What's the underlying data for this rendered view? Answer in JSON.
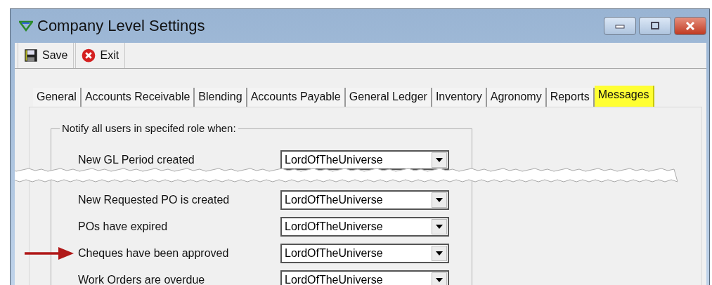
{
  "window": {
    "title": "Company Level Settings"
  },
  "toolbar": [
    {
      "label": "Save",
      "kind": "save"
    },
    {
      "label": "Exit",
      "kind": "exit"
    }
  ],
  "tabs": [
    {
      "label": "General",
      "selected": false
    },
    {
      "label": "Accounts Receivable",
      "selected": false
    },
    {
      "label": "Blending",
      "selected": false
    },
    {
      "label": "Accounts Payable",
      "selected": false
    },
    {
      "label": "General Ledger",
      "selected": false
    },
    {
      "label": "Inventory",
      "selected": false
    },
    {
      "label": "Agronomy",
      "selected": false
    },
    {
      "label": "Reports",
      "selected": false
    },
    {
      "label": "Messages",
      "selected": true
    }
  ],
  "group": {
    "title": "Notify all users in specifed role when:",
    "rows": [
      {
        "kind": "setting",
        "label": "New GL Period created",
        "value": "LordOfTheUniverse"
      },
      {
        "kind": "tear"
      },
      {
        "kind": "setting",
        "label": "New Requested PO is created",
        "value": "LordOfTheUniverse"
      },
      {
        "kind": "setting",
        "label": "POs have expired",
        "value": "LordOfTheUniverse"
      },
      {
        "kind": "setting",
        "label": "Cheques have been approved",
        "value": "LordOfTheUniverse",
        "marked": true
      },
      {
        "kind": "setting",
        "label": "Work Orders are overdue",
        "value": "LordOfTheUniverse"
      }
    ]
  }
}
